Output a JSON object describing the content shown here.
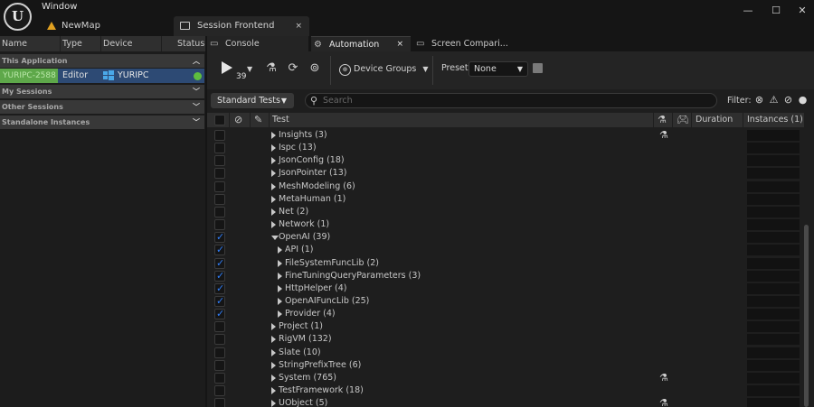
{
  "window": {
    "menu": "Window",
    "controls": [
      "—",
      "☐",
      "✕"
    ]
  },
  "doc_tabs": {
    "newmap": "NewMap",
    "session_frontend": "Session Frontend",
    "close": "×"
  },
  "left_panel": {
    "columns": [
      "Name",
      "Type",
      "Device",
      "Status"
    ],
    "sections": {
      "this_application": "This Application",
      "my_sessions": "My Sessions",
      "other_sessions": "Other Sessions",
      "standalone_instances": "Standalone Instances"
    },
    "session": {
      "name": "YURIPC-2588",
      "type": "Editor",
      "device": "YURIPC"
    }
  },
  "sub_tabs": {
    "console": "Console",
    "automation": "Automation",
    "screen_comparison": "Screen Compari...",
    "close": "×"
  },
  "toolbar": {
    "run_count": "39",
    "device_groups": "Device Groups",
    "preset_label": "Preset:",
    "preset_value": "None"
  },
  "filter": {
    "standard_tests": "Standard Tests",
    "search_placeholder": "Search",
    "filter_label": "Filter:"
  },
  "table": {
    "columns": {
      "test": "Test",
      "duration": "Duration",
      "instances": "Instances (1)"
    },
    "rows": [
      {
        "label": "Insights (3)",
        "depth": 0,
        "checked": false,
        "expanded": false,
        "flask": true
      },
      {
        "label": "Ispc (13)",
        "depth": 0,
        "checked": false,
        "expanded": false,
        "flask": false
      },
      {
        "label": "JsonConfig (18)",
        "depth": 0,
        "checked": false,
        "expanded": false,
        "flask": false
      },
      {
        "label": "JsonPointer (13)",
        "depth": 0,
        "checked": false,
        "expanded": false,
        "flask": false
      },
      {
        "label": "MeshModeling (6)",
        "depth": 0,
        "checked": false,
        "expanded": false,
        "flask": false
      },
      {
        "label": "MetaHuman (1)",
        "depth": 0,
        "checked": false,
        "expanded": false,
        "flask": false
      },
      {
        "label": "Net (2)",
        "depth": 0,
        "checked": false,
        "expanded": false,
        "flask": false
      },
      {
        "label": "Network (1)",
        "depth": 0,
        "checked": false,
        "expanded": false,
        "flask": false
      },
      {
        "label": "OpenAI (39)",
        "depth": 0,
        "checked": true,
        "expanded": true,
        "flask": false
      },
      {
        "label": "API (1)",
        "depth": 1,
        "checked": true,
        "expanded": false,
        "flask": false
      },
      {
        "label": "FileSystemFuncLib (2)",
        "depth": 1,
        "checked": true,
        "expanded": false,
        "flask": false
      },
      {
        "label": "FineTuningQueryParameters (3)",
        "depth": 1,
        "checked": true,
        "expanded": false,
        "flask": false
      },
      {
        "label": "HttpHelper (4)",
        "depth": 1,
        "checked": true,
        "expanded": false,
        "flask": false
      },
      {
        "label": "OpenAIFuncLib (25)",
        "depth": 1,
        "checked": true,
        "expanded": false,
        "flask": false
      },
      {
        "label": "Provider (4)",
        "depth": 1,
        "checked": true,
        "expanded": false,
        "flask": false
      },
      {
        "label": "Project (1)",
        "depth": 0,
        "checked": false,
        "expanded": false,
        "flask": false
      },
      {
        "label": "RigVM (132)",
        "depth": 0,
        "checked": false,
        "expanded": false,
        "flask": false
      },
      {
        "label": "Slate (10)",
        "depth": 0,
        "checked": false,
        "expanded": false,
        "flask": false
      },
      {
        "label": "StringPrefixTree (6)",
        "depth": 0,
        "checked": false,
        "expanded": false,
        "flask": false
      },
      {
        "label": "System (765)",
        "depth": 0,
        "checked": false,
        "expanded": false,
        "flask": true
      },
      {
        "label": "TestFramework (18)",
        "depth": 0,
        "checked": false,
        "expanded": false,
        "flask": false
      },
      {
        "label": "UObject (5)",
        "depth": 0,
        "checked": false,
        "expanded": false,
        "flask": true
      }
    ]
  },
  "colors": {
    "session_name_bg": "#5ea84a",
    "session_row_bg": "#2d4a74",
    "status_online": "#5ebd3e",
    "checkbox_accent": "#2f7cf6"
  },
  "icons": {
    "run": "play-icon",
    "run_dropdown": "chevron-down-icon",
    "clear": "clear-results-icon",
    "refresh": "refresh-icon",
    "find": "find-workers-icon",
    "device_groups": "globe-icon",
    "save": "save-icon",
    "search": "search-icon"
  }
}
